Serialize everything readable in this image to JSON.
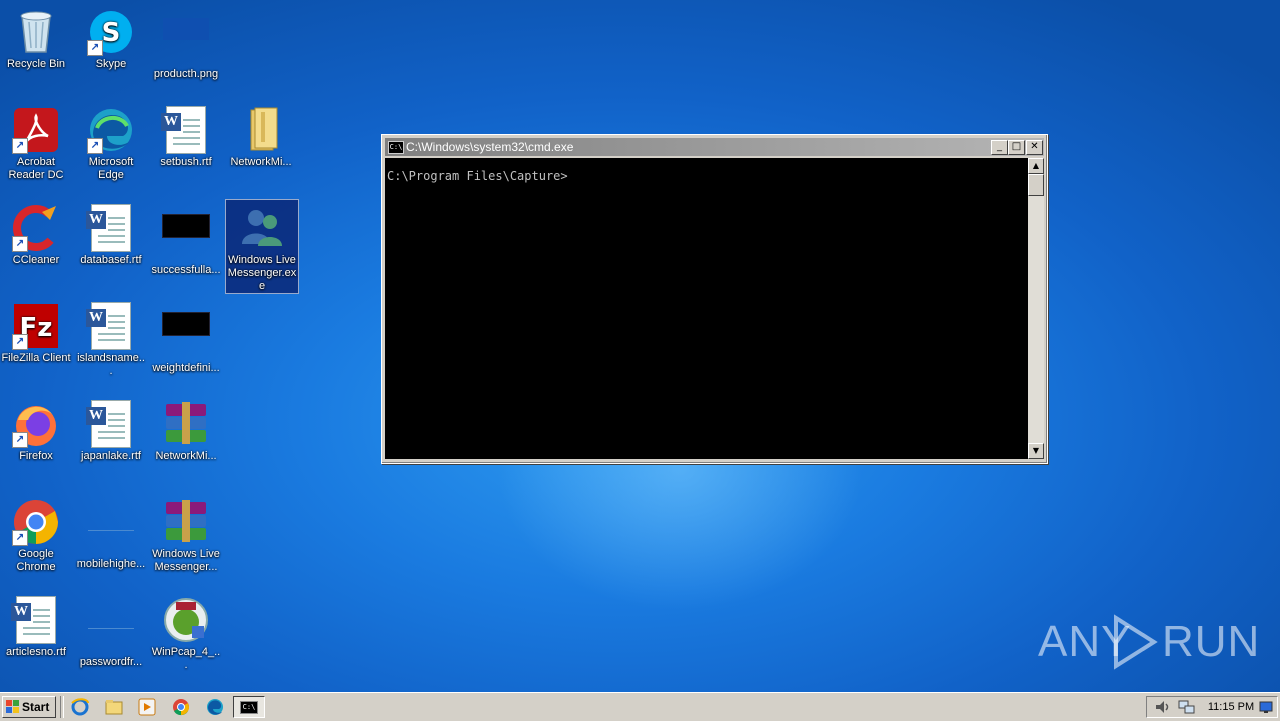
{
  "desktop": {
    "icons": [
      {
        "label": "Recycle Bin"
      },
      {
        "label": "Skype"
      },
      {
        "label": "producth.png"
      },
      {
        "label": "Acrobat Reader DC"
      },
      {
        "label": "Microsoft Edge"
      },
      {
        "label": "setbush.rtf"
      },
      {
        "label": "NetworkMi..."
      },
      {
        "label": "CCleaner"
      },
      {
        "label": "databasef.rtf"
      },
      {
        "label": "successfulla..."
      },
      {
        "label": "Windows Live Messenger.exe"
      },
      {
        "label": "FileZilla Client"
      },
      {
        "label": "islandsname..."
      },
      {
        "label": "weightdefini..."
      },
      {
        "label": "Firefox"
      },
      {
        "label": "japanlake.rtf"
      },
      {
        "label": "NetworkMi..."
      },
      {
        "label": "Google Chrome"
      },
      {
        "label": "mobilehighe..."
      },
      {
        "label": "Windows Live Messenger..."
      },
      {
        "label": "articlesno.rtf"
      },
      {
        "label": "passwordfr..."
      },
      {
        "label": "WinPcap_4_..."
      }
    ]
  },
  "cmd_window": {
    "title": "C:\\Windows\\system32\\cmd.exe",
    "prompt": "C:\\Program Files\\Capture>",
    "icon_text": "C:\\",
    "minimize": "_",
    "maximize": "□",
    "close": "✕",
    "scroll_up": "▲",
    "scroll_down": "▼"
  },
  "watermark": {
    "left": "ANY",
    "right": "RUN"
  },
  "taskbar": {
    "start_label": "Start",
    "clock": "11:15 PM",
    "cmd_icon_text": "C:\\"
  },
  "colors": {
    "desktop_blue": "#1a7be0",
    "taskbar": "#d4d0c8",
    "console_bg": "#000000"
  }
}
